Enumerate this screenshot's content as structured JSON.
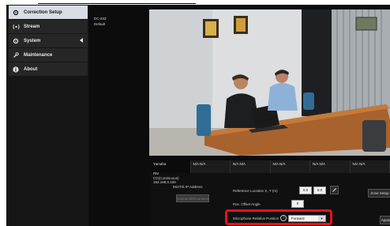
{
  "sidebar": {
    "items": [
      {
        "label": "Correction Setup",
        "icon": "gear-icon",
        "active": true
      },
      {
        "label": "Stream",
        "icon": "stream-icon"
      },
      {
        "label": "System",
        "icon": "system-icon",
        "expandable": true
      },
      {
        "label": "Maintenance",
        "icon": "wrench-icon"
      },
      {
        "label": "About",
        "icon": "info-icon"
      }
    ]
  },
  "device": {
    "model": "DC-333",
    "name": "Default"
  },
  "tabs": [
    {
      "line1": "Yamaha",
      "line2": "RM",
      "line3": "CG(Continuous)"
    },
    {
      "line1": "N/A N/A"
    },
    {
      "line1": "N/A N/A"
    },
    {
      "line1": "N/A N/A"
    },
    {
      "line1": "N/A N/A"
    },
    {
      "line1": "N/A N/A"
    }
  ],
  "tab_detail": {
    "ip": "192.168.0.100"
  },
  "panel": {
    "mic_ip_label": "Mic/Trk IP Address",
    "connect_button": "Connect/Disconnect",
    "ref_location_label": "Reference Location X, Y (m)",
    "ref_x": "0.0",
    "ref_y": "0.0",
    "pos_offset_label": "Pos. Offset Angle",
    "pos_offset_value": "0",
    "relative_position_label": "Microphone Relative Position",
    "relative_position_value": "Forward",
    "zone_setup_button": "Zone Setup",
    "apply_button": "Apply"
  },
  "colors": {
    "highlight": "#e4141a",
    "active_nav": "#d9dde3"
  }
}
